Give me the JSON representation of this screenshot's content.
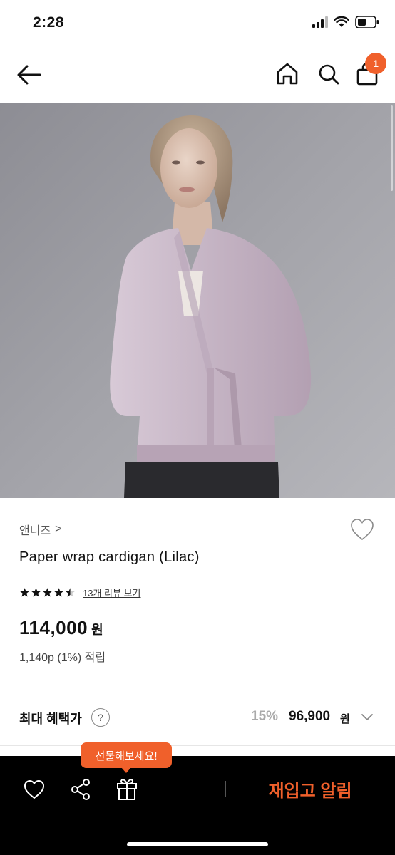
{
  "status_bar": {
    "time": "2:28",
    "icons": [
      "signal-icon",
      "wifi-icon",
      "battery-icon"
    ]
  },
  "nav": {
    "icons": [
      "back-arrow-icon",
      "home-icon",
      "search-icon",
      "shopping-bag-icon"
    ],
    "cart_count": "1"
  },
  "product": {
    "image_subject": "model wearing lilac wrap cardigan",
    "brand": "앤니즈",
    "brand_chevron": ">",
    "name": "Paper wrap cardigan (Lilac)",
    "rating": 4.5,
    "rating_max": 5,
    "review_link": "13개 리뷰 보기",
    "price": "114,000",
    "price_unit": "원",
    "points": "1,140p (1%) 적립"
  },
  "benefit": {
    "label": "최대 혜택가",
    "help": "?",
    "rate": "15%",
    "price": "96,900",
    "unit": "원"
  },
  "bottom_bar": {
    "icons": [
      "heart-icon",
      "share-icon",
      "gift-icon"
    ],
    "gift_tooltip": "선물해보세요!",
    "restock_label": "재입고 알림"
  },
  "colors": {
    "accent": "#f0602b",
    "bottom_bar_bg": "#000000",
    "cardigan": "#c9b9c8"
  }
}
